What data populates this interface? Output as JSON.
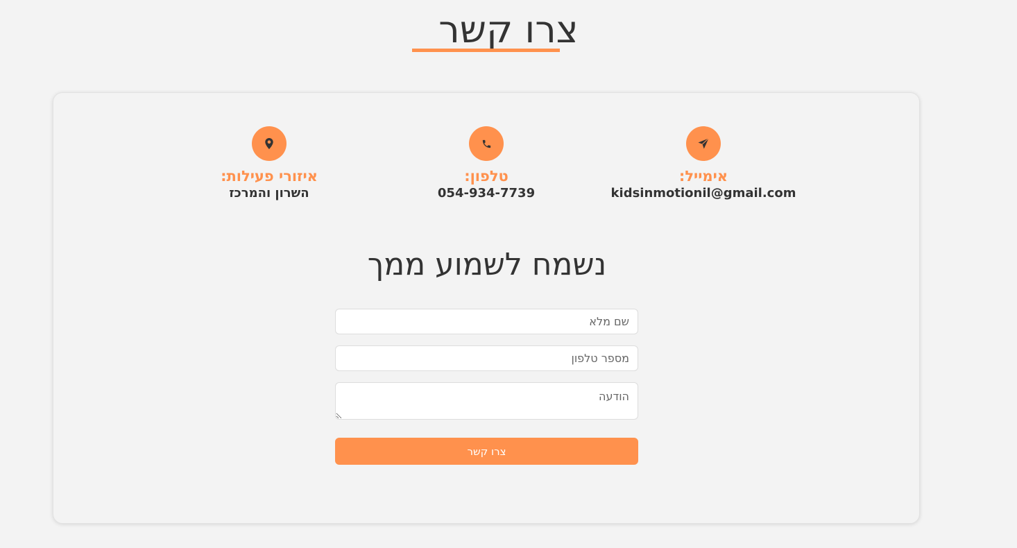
{
  "header": {
    "title": "צרו קשר"
  },
  "contact_info": {
    "email": {
      "label": "אימייל:",
      "value": "kidsinmotionil@gmail.com",
      "icon": "paper-plane-icon"
    },
    "phone": {
      "label": "טלפון:",
      "value": "054-934-7739",
      "icon": "phone-icon"
    },
    "area": {
      "label": "איזורי פעילות:",
      "value": "השרון והמרכז",
      "icon": "map-marker-icon"
    }
  },
  "form": {
    "heading": "נשמח לשמוע ממך",
    "name_placeholder": "שם מלא",
    "phone_placeholder": "מספר טלפון",
    "message_placeholder": "הודעה",
    "submit_label": "צרו קשר"
  },
  "colors": {
    "accent": "#ff914d",
    "background": "#f3f3f3",
    "text": "#333333"
  }
}
